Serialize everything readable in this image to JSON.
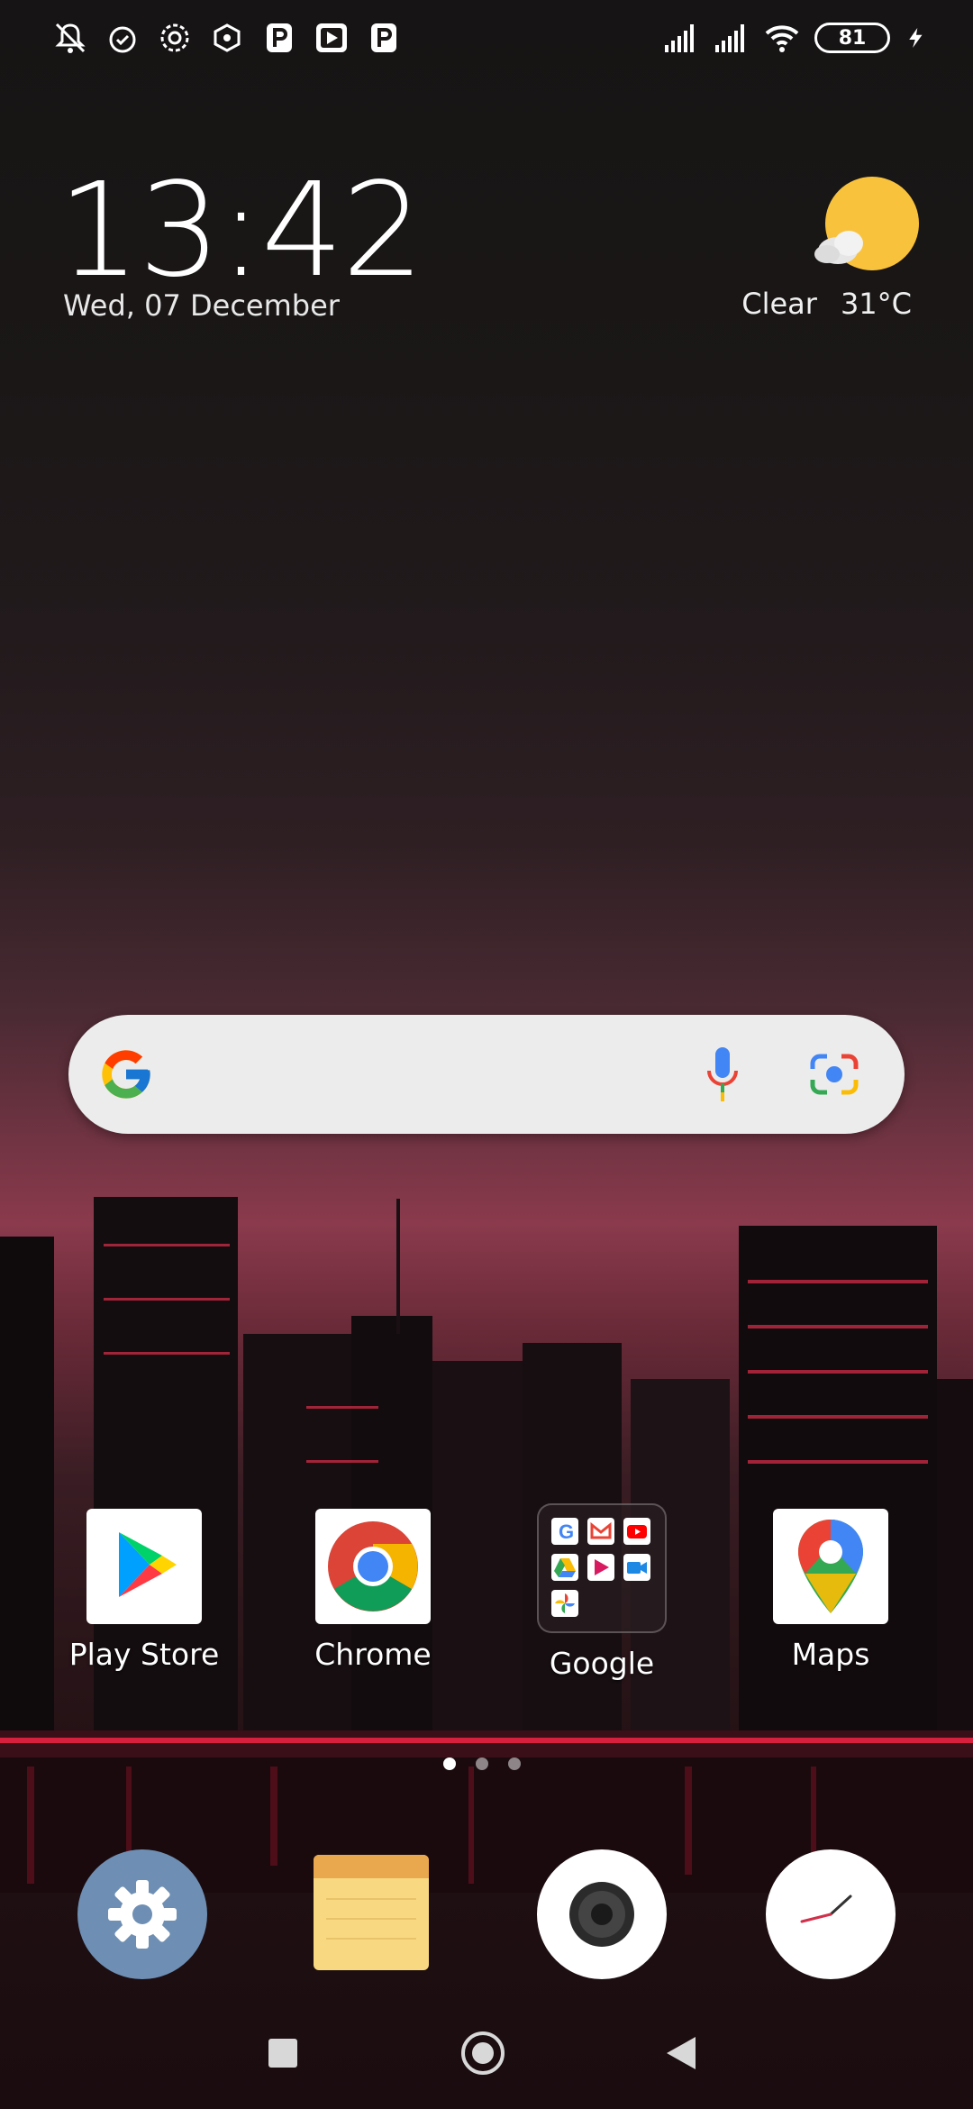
{
  "status_bar": {
    "left_icons": [
      "notifications-off-icon",
      "alarm-icon",
      "gear-badge-icon",
      "hexagon-icon",
      "p-app-icon",
      "media-app-icon",
      "p-app-icon"
    ],
    "right_icons": [
      "signal-icon",
      "signal-icon",
      "wifi-icon",
      "battery-icon",
      "charging-icon"
    ],
    "battery_level": "81"
  },
  "clock": {
    "time": "13:42",
    "date": "Wed, 07 December"
  },
  "weather": {
    "condition": "Clear",
    "temperature": "31°C",
    "icon": "sun-cloud-icon"
  },
  "search": {
    "icons": [
      "google-g-icon",
      "microphone-icon",
      "google-lens-icon"
    ]
  },
  "apps": [
    {
      "label": "Play Store",
      "icon": "play-store-icon"
    },
    {
      "label": "Chrome",
      "icon": "chrome-icon"
    },
    {
      "label": "Google",
      "icon": "google-folder-icon"
    },
    {
      "label": "Maps",
      "icon": "maps-icon"
    }
  ],
  "page_indicator": {
    "pages": 3,
    "active": 1
  },
  "dock": [
    {
      "icon": "settings-icon"
    },
    {
      "icon": "notes-icon"
    },
    {
      "icon": "camera-icon"
    },
    {
      "icon": "clock-icon"
    }
  ],
  "navbar": [
    "recents-button",
    "home-button",
    "back-button"
  ],
  "colors": {
    "sun": "#f9c23c",
    "settings_bg": "#6e8fb3",
    "notes_top": "#eaa84e",
    "notes_body": "#f8d982"
  }
}
